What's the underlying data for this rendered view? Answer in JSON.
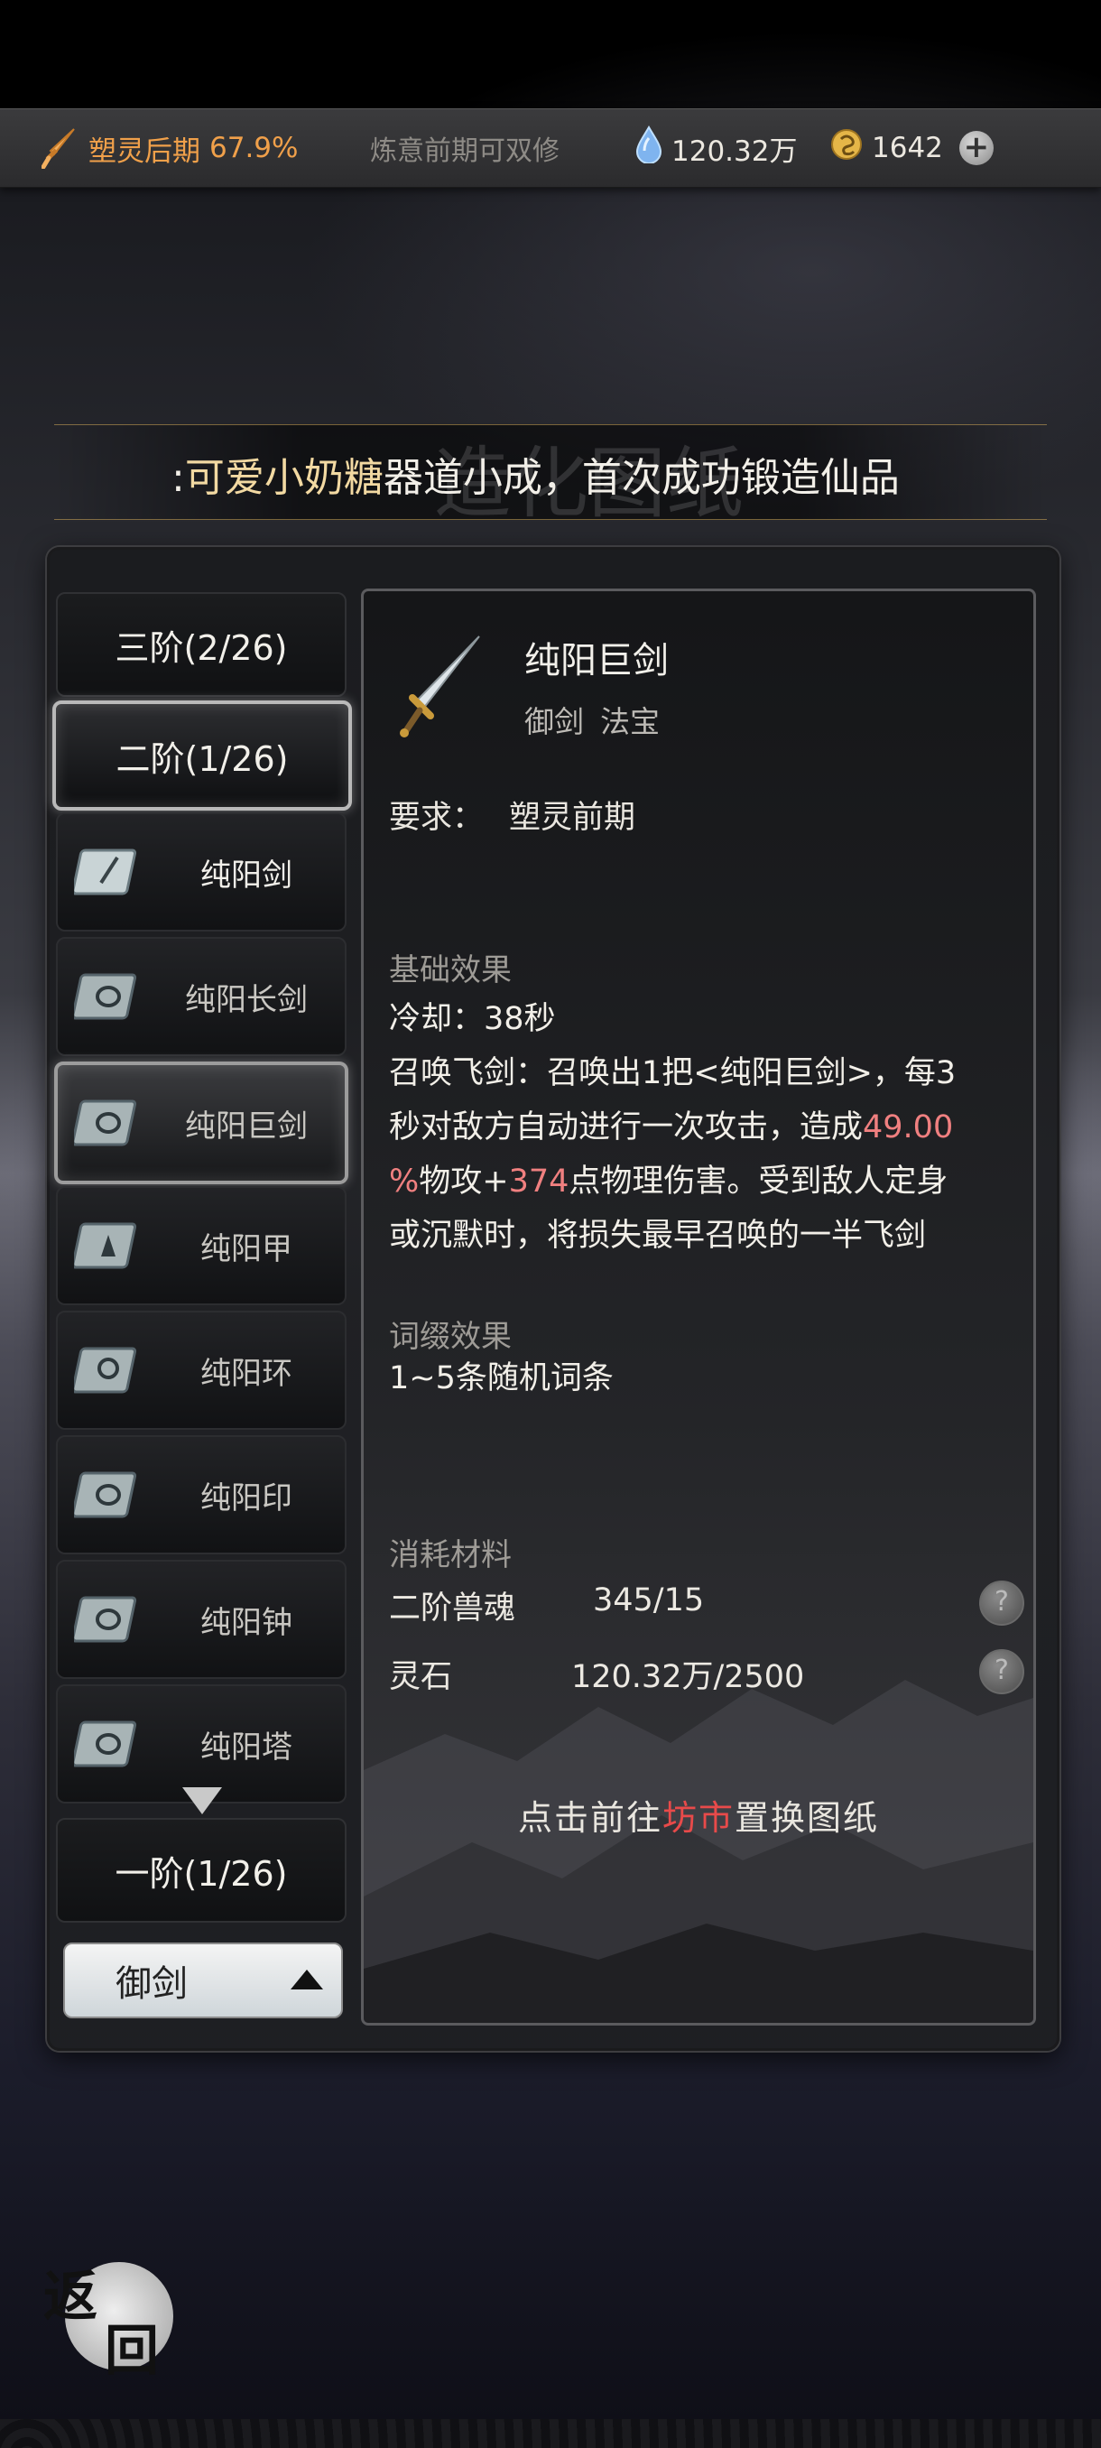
{
  "topbar": {
    "realm": "塑灵后期",
    "realm_pct": "67.9%",
    "hint": "炼意前期可双修",
    "spirit_stones": "120.32万",
    "gold": "1642",
    "icons": [
      "sword-icon",
      "water-drop-icon",
      "coin-icon",
      "plus-icon"
    ]
  },
  "marquee": {
    "ghost_title": "造化图纸",
    "prefix": ":",
    "player_name": "可爱小奶糖",
    "message": "器道小成，首次成功锻造仙品"
  },
  "tiers": {
    "tier3": "三阶(2/26)",
    "tier2": "二阶(1/26)",
    "tier1": "一阶(1/26)"
  },
  "items": [
    {
      "label": "纯阳剑"
    },
    {
      "label": "纯阳长剑"
    },
    {
      "label": "纯阳巨剑"
    },
    {
      "label": "纯阳甲"
    },
    {
      "label": "纯阳环"
    },
    {
      "label": "纯阳印"
    },
    {
      "label": "纯阳钟"
    },
    {
      "label": "纯阳塔"
    }
  ],
  "type_select": {
    "value": "御剑"
  },
  "detail": {
    "title": "纯阳巨剑",
    "tag1": "御剑",
    "tag2": "法宝",
    "req_label": "要求：",
    "req_value": "塑灵前期",
    "base_title": "基础效果",
    "cooldown": "冷却：38秒",
    "effect_l1": "召唤飞剑：召唤出1把<纯阳巨剑>，每3",
    "effect_l2a": "秒对敌方自动进行一次攻击，造成",
    "effect_l2b": "49.00",
    "effect_l3a": "%",
    "effect_l3b": "物攻+",
    "effect_l3c": "374",
    "effect_l3d": "点物理伤害。受到敌人定身",
    "effect_l4": "或沉默时，将损失最早召唤的一半飞剑",
    "affix_title": "词缀效果",
    "affix": "1~5条随机词条",
    "mat_title": "消耗材料",
    "mat1_name": "二阶兽魂",
    "mat1_qty": "345/15",
    "mat2_name": "灵石",
    "mat2_qty": "120.32万/2500",
    "goto_a": "点击前往",
    "goto_link": "坊市",
    "goto_b": "置换图纸",
    "help": "?"
  },
  "back": {
    "c1": "返",
    "c2": "回"
  },
  "colors": {
    "accent_orange": "#f0a04a",
    "highlight_red": "#f08080",
    "link_red": "#e84a4a"
  }
}
